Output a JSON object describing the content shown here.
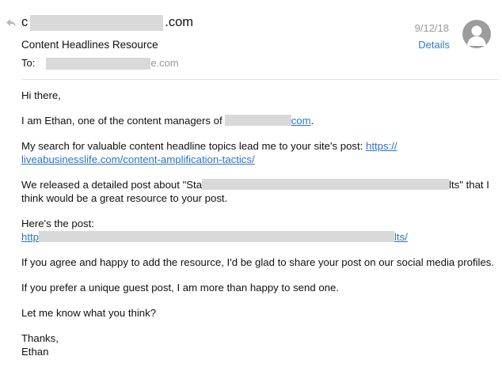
{
  "header": {
    "from_prefix": "c",
    "from_suffix": ".com",
    "subject": "Content Headlines Resource",
    "to_label": "To:",
    "to_suffix": "e.com",
    "date": "9/12/18",
    "details_label": "Details"
  },
  "body": {
    "greeting": "Hi there,",
    "intro_before": "I am Ethan, one of the content managers of",
    "intro_link_suffix": "com",
    "intro_after": ".",
    "search_text": "My search for valuable content headline topics lead me to your site's post: ",
    "search_link_line1": "https://",
    "search_link_line2": "liveabusinesslife.com/content-amplification-tactics/",
    "released_before": "We released a detailed post about \"Sta",
    "released_after": "lts\" that I think would be a great resource to your post.",
    "post_label": "Here's the post:",
    "post_link_prefix": "http",
    "post_link_suffix": "lts/",
    "agree_text": "If you agree and happy to add the resource, I'd be glad to share your post on our social media profiles.",
    "guest_text": "If you prefer a unique guest post, I am more than happy to send one.",
    "question_text": "Let me know what you think?",
    "thanks": "Thanks,",
    "signature": "Ethan"
  },
  "colors": {
    "link": "#2a74c7",
    "details": "#2f7bd6",
    "redaction": "#d9d9d9",
    "avatar": "#9c9c9c"
  },
  "icons": [
    "reply-icon",
    "avatar-person-icon"
  ]
}
